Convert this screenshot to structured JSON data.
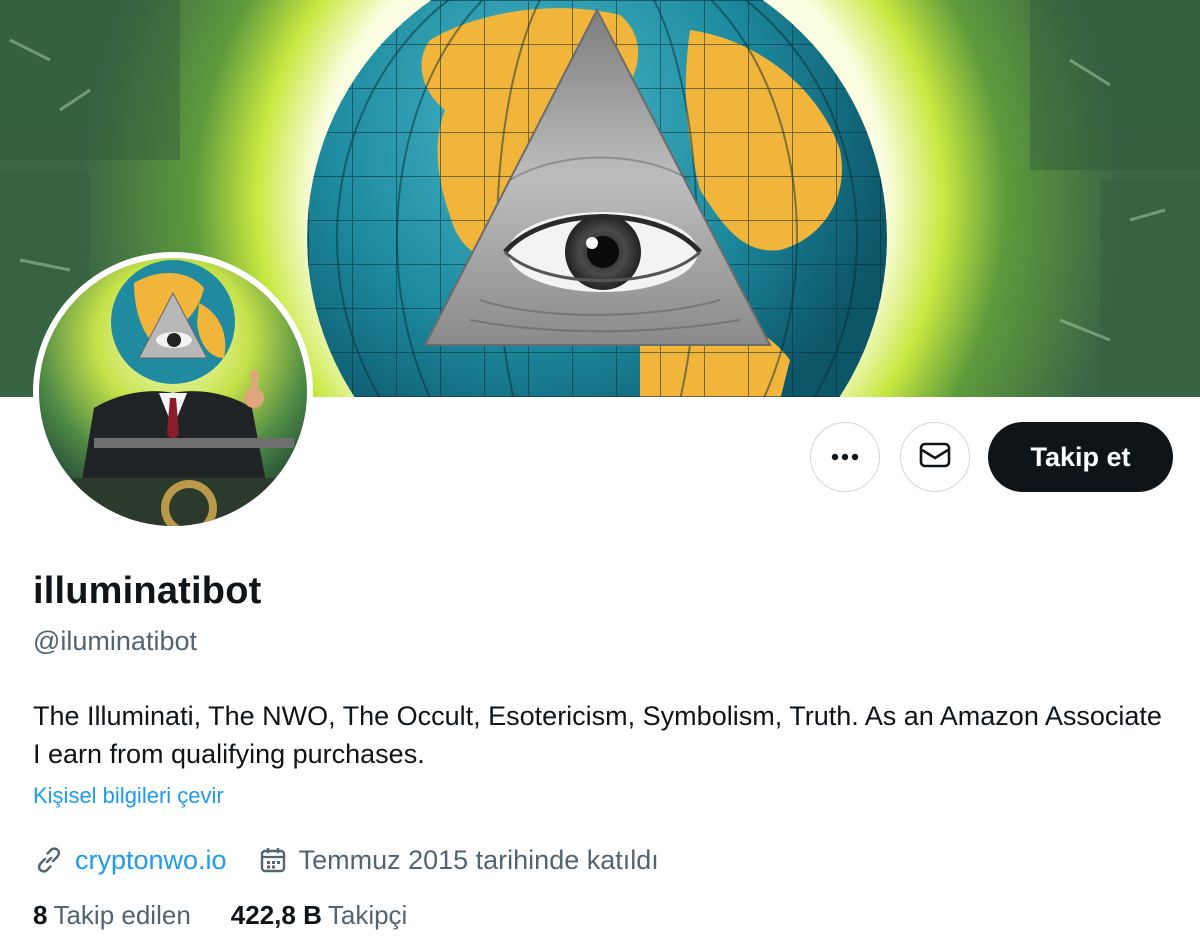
{
  "profile": {
    "display_name": "illuminatibot",
    "handle": "@iluminatibot",
    "bio": "The Illuminati, The NWO, The Occult, Esotericism, Symbolism, Truth. As an Amazon Associate I earn from qualifying purchases.",
    "translate_label": "Kişisel bilgileri çevir",
    "website": "cryptonwo.io",
    "joined": "Temmuz 2015 tarihinde katıldı",
    "following_count": "8",
    "following_label": "Takip edilen",
    "followers_count": "422,8 B",
    "followers_label": "Takipçi"
  },
  "actions": {
    "more_icon": "more-horizontal-icon",
    "message_icon": "envelope-icon",
    "follow_label": "Takip et"
  },
  "icons": {
    "website": "link-icon",
    "joined": "calendar-icon"
  },
  "colors": {
    "text_primary": "#0f1419",
    "text_secondary": "#536471",
    "link": "#1d9bf0",
    "follow_bg": "#0f1419"
  }
}
